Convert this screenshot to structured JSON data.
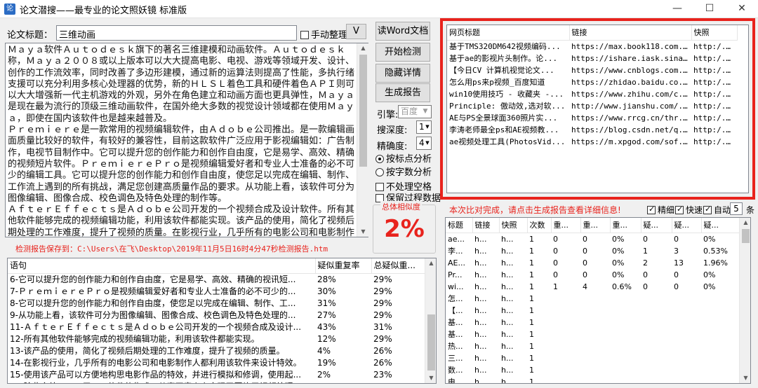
{
  "window": {
    "title": "论文潜搜——最专业的论文照妖镜 标准版",
    "minimize": "—",
    "maximize": "☐",
    "close": "✕"
  },
  "form": {
    "title_label": "论文标题：",
    "title_value": "三维动画",
    "manual_sort_label": "手动整理",
    "v_button": "V",
    "accent": "#e8231d"
  },
  "paper_text": [
    "Ｍａｙａ软件Ａｕｔｏｄｅｓｋ旗下的著名三维建模和动画软件。Ａｕｔｏｄｅｓｋ称，Ｍａｙａ２００８或以上版本可以大大提高电影、电视、游戏等领域开发、设计、创作的工作流效率，同时改善了多边形建模，通过新的运算法则提高了性能，多执行绪支援可以充分利用多核心处理器的优势，新的ＨＬＳＬ着色工具和硬件着色ＡＰＩ则可以大大增强新一代主机游戏的外观，另外在角色建立和动画方面也更具弹性，Ｍａｙａ是现在最为流行的顶级三维动画软件，在国外绝大多数的视觉设计领域都在使用Ｍａｙａ，即使在国内该软件也是越来越普及。",
    "Ｐｒｅｍｉｅｒｅ是一款常用的视频编辑软件，由Ａｄｏｂｅ公司推出。是一款编辑画面质量比较好的软件，有较好的兼容性，目前这款软件广泛应用于影视编辑如：广告制作，电视节目制作中。它可以提升您的创作能力和创作自由度，它是易学、高效、精确的视频短片软件。ＰｒｅｍｉｅｒｅＰｒｏ是视频编辑爱好者和专业人士准备的必不可少的编辑工具。它可以提升您的创作能力和创作自由度，使您足以完成在编辑、制作、工作流上遇到的所有挑战，满足您创建高质量作品的要求。从功能上看，该软件可分为图像编辑、图像合成、校色调色及特色处理的制作等。",
    "ＡｆｔｅｒＥｆｆｅｃｔｓ是Ａｄｏｂｅ公司开发的一个视频合成及设计软件。所有其他软件能够完成的视频编辑功能，利用该软件都能实现。该产品的使用，简化了视频后期处理的工作难度，提升了视频的质量。在影视行业，几乎所有的电影公司和电影制作人都利用该软件来设计特效。使用该产品可以方便地构思电影作品的特效，并进行模拟和修调，使用起来"
  ],
  "buttons": {
    "read_word": "读Word文档",
    "start": "开始检测",
    "hide_details": "隐藏详情",
    "report": "生成报告"
  },
  "options": {
    "engine_label": "引擎:",
    "engine_value": "百度",
    "depth_label": "搜深度:",
    "depth_value": "1",
    "precision_label": "精确度:",
    "precision_value": "4",
    "radio_punct": "按标点分析",
    "radio_chars": "按字数分析",
    "no_space": "不处理空格",
    "keep_process": "保留过程数据"
  },
  "similarity": {
    "label": "总体相似度",
    "value": "2%"
  },
  "save_path": "检测报告保存到：C:\\Users\\在飞\\Desktop\\2019年11月5日16时4分47秒检测报告.htm",
  "web_results": {
    "headers": [
      "网页标题",
      "链接",
      "快照"
    ],
    "rows": [
      [
        "基于TMS320DM642视频编码...",
        "https://max.book118.com...",
        "http:/..."
      ],
      [
        "基于ae的影视片头制作。论...",
        "https://ishare.iask.sina...",
        "http:/..."
      ],
      [
        "【今日CV 计算机视觉论文...",
        "https://www.cnblogs.com...",
        "http:/..."
      ],
      [
        "怎么用ps来p视频_百度知道",
        "https://zhidao.baidu.co...",
        "http:/..."
      ],
      [
        "win10使用技巧 - 收藏夹 -...",
        "https://www.zhihu.com/c...",
        "http:/..."
      ],
      [
        "Principle: 傲动效,选对软...",
        "http://www.jianshu.com/...",
        "http:/..."
      ],
      [
        "AE与PS全景球面360照片实...",
        "https://www.rrcg.cn/thr...",
        "http:/..."
      ],
      [
        "李涛老师最全ps和AE视频教...",
        "https://blog.csdn.net/q...",
        "http:/..."
      ],
      [
        "ae视频处理工具(PhotosVid...",
        "https://m.xpgod.com/sof...",
        "http:/..."
      ]
    ]
  },
  "status": {
    "message": "本次比对完成，请点击生成报告查看详细信息!",
    "precise_label": "精细",
    "fast_label": "快速",
    "auto_label": "自动",
    "count_value": "5",
    "count_unit": "条"
  },
  "compare": {
    "headers": [
      "标题",
      "链接",
      "快照",
      "次数",
      "重...",
      "重...",
      "重...",
      "疑...",
      "疑...",
      "疑..."
    ],
    "rows": [
      [
        "ae...",
        "h...",
        "h...",
        "1",
        "0",
        "0",
        "0%",
        "0",
        "0",
        "0%"
      ],
      [
        "李...",
        "h...",
        "h...",
        "1",
        "0",
        "0",
        "0%",
        "1",
        "3",
        "0.53%"
      ],
      [
        "AE...",
        "h...",
        "h...",
        "1",
        "0",
        "0",
        "0%",
        "2",
        "13",
        "1.96%"
      ],
      [
        "Pr...",
        "h...",
        "h...",
        "1",
        "0",
        "0",
        "0%",
        "0",
        "0",
        "0%"
      ],
      [
        "wi...",
        "h...",
        "h...",
        "1",
        "1",
        "4",
        "0.6%",
        "0",
        "0",
        "0%"
      ],
      [
        "怎...",
        "h...",
        "h...",
        "1",
        "",
        "",
        "",
        "",
        "",
        ""
      ],
      [
        "【...",
        "h...",
        "h...",
        "1",
        "",
        "",
        "",
        "",
        "",
        ""
      ],
      [
        "基...",
        "h...",
        "h...",
        "1",
        "",
        "",
        "",
        "",
        "",
        ""
      ],
      [
        "基...",
        "h...",
        "h...",
        "1",
        "",
        "",
        "",
        "",
        "",
        ""
      ],
      [
        "热...",
        "h...",
        "h...",
        "1",
        "",
        "",
        "",
        "",
        "",
        ""
      ],
      [
        "三...",
        "h...",
        "h...",
        "1",
        "",
        "",
        "",
        "",
        "",
        ""
      ],
      [
        "数...",
        "h...",
        "h...",
        "1",
        "",
        "",
        "",
        "",
        "",
        ""
      ],
      [
        "电...",
        "h...",
        "h...",
        "1",
        "",
        "",
        "",
        "",
        "",
        ""
      ],
      [
        "家...",
        "h...",
        "h...",
        "1",
        "",
        "",
        "",
        "",
        "",
        ""
      ]
    ]
  },
  "sentences": {
    "headers": [
      "语句",
      "疑似重复率",
      "总疑似重..."
    ],
    "rows": [
      [
        "6-它可以提升您的创作能力和创作自由度，它是易学、高效、精确的视讯短...",
        "28%",
        "29%"
      ],
      [
        "7-ＰｒｅｍｉｅｒｅＰｒｏ是视频编辑爱好者和专业人士准备的必不可少的...",
        "30%",
        "29%"
      ],
      [
        "8-它可以提升您的创作能力和创作自由度，使您足以完成在编辑、制作、工...",
        "31%",
        "29%"
      ],
      [
        "9-从功能上看，该软件可分为图像编辑、图像合成、校色调色及特色处理的...",
        "27%",
        "29%"
      ],
      [
        "11-ＡｆｔｅｒＥｆｆｅｃｔｓ是Ａｄｏｂｅ公司开发的一个视频合成及设计...",
        "43%",
        "31%"
      ],
      [
        "12-所有其他软件能够完成的视频编辑功能，利用该软件都能实现。",
        "12%",
        "29%"
      ],
      [
        "13-该产品的使用，简化了视频后期处理的工作难度，提升了视频的质量。",
        "4%",
        "26%"
      ],
      [
        "14-在影视行业，几乎所有的电影公司和电影制作人都利用该软件来设计特效。",
        "19%",
        "26%"
      ],
      [
        "15-使用该产品可以方便地构思电影作品的特效，并进行模拟和修调，使用起...",
        "2%",
        "23%"
      ],
      [
        "16-除此之外，ＡＥ于ＰＳ软件的集成，从真正意义上实现了图片于视频处理...",
        "4%",
        "23%"
      ]
    ]
  }
}
